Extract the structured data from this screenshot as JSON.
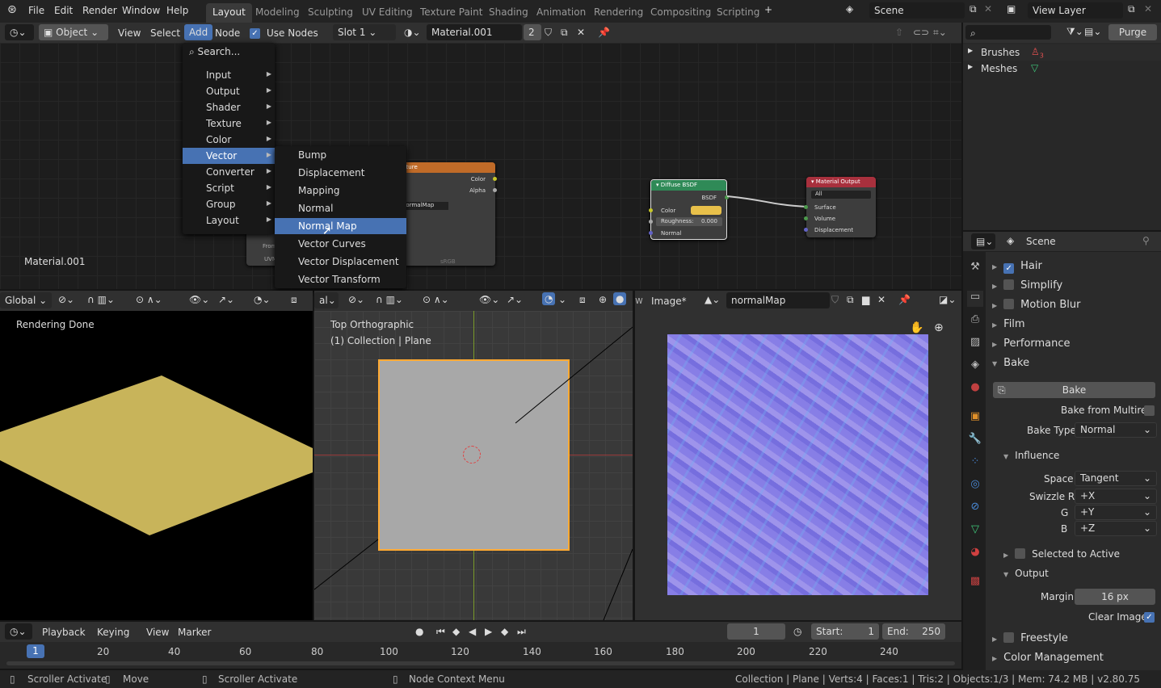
{
  "topbar": {
    "menus": [
      "File",
      "Edit",
      "Render",
      "Window",
      "Help"
    ],
    "workspaces": [
      "Layout",
      "Modeling",
      "Sculpting",
      "UV Editing",
      "Texture Paint",
      "Shading",
      "Animation",
      "Rendering",
      "Compositing",
      "Scripting"
    ],
    "active_workspace": "Layout",
    "scene": "Scene",
    "view_layer": "View Layer"
  },
  "node_header": {
    "mode": "Object",
    "menus": [
      "View",
      "Select",
      "Add",
      "Node"
    ],
    "use_nodes": "Use Nodes",
    "slot": "Slot 1",
    "material": "Material.001",
    "users": "2"
  },
  "node_editor": {
    "material_label": "Material.001",
    "image_node": {
      "title": "Image Texture",
      "out_color": "Color",
      "out_alpha": "Alpha",
      "image": "normalMap",
      "colorspace": "sRGB",
      "from": "From",
      "uv": "UVMap"
    },
    "diffuse": {
      "title": "Diffuse BSDF",
      "out": "BSDF",
      "color": "Color",
      "roughness_label": "Roughness:",
      "roughness": "0.000",
      "normal": "Normal",
      "color_hex": "#e8c04a"
    },
    "output": {
      "title": "Material Output",
      "target": "All",
      "surface": "Surface",
      "volume": "Volume",
      "displacement": "Displacement"
    }
  },
  "add_menu": {
    "search": "Search...",
    "items": [
      "Input",
      "Output",
      "Shader",
      "Texture",
      "Color",
      "Vector",
      "Converter",
      "Script",
      "Group",
      "Layout"
    ],
    "active": "Vector"
  },
  "vector_menu": {
    "items": [
      "Bump",
      "Displacement",
      "Mapping",
      "Normal",
      "Normal Map",
      "Vector Curves",
      "Vector Displacement",
      "Vector Transform"
    ],
    "highlighted": "Normal Map"
  },
  "outliner": {
    "purge": "Purge",
    "items": [
      "Brushes",
      "Meshes"
    ],
    "brush_count": "3"
  },
  "properties": {
    "context": "Scene",
    "panels": [
      {
        "label": "Hair",
        "check": true
      },
      {
        "label": "Simplify",
        "check": false
      },
      {
        "label": "Motion Blur",
        "check": false
      },
      {
        "label": "Film"
      },
      {
        "label": "Performance"
      }
    ],
    "bake": {
      "title": "Bake",
      "button": "Bake",
      "from_multires": "Bake from Multires",
      "type_label": "Bake Type",
      "type": "Normal",
      "influence": "Influence",
      "space_label": "Space",
      "space": "Tangent",
      "swizzle_r_label": "Swizzle R",
      "swizzle_r": "+X",
      "g_label": "G",
      "g": "+Y",
      "b_label": "B",
      "b": "+Z",
      "selected_to_active": "Selected to Active",
      "output": "Output",
      "margin_label": "Margin",
      "margin": "16 px",
      "clear_image": "Clear Image"
    },
    "freestyle": "Freestyle",
    "color_management": "Color Management"
  },
  "render_view": {
    "transform": "Global",
    "status": "Rendering Done"
  },
  "viewport": {
    "transform": "al",
    "view": "Top Orthographic",
    "collection": "(1) Collection | Plane"
  },
  "image_editor": {
    "view": "w",
    "menu": "Image*",
    "image": "normalMap"
  },
  "timeline": {
    "menus": [
      "Playback",
      "Keying",
      "View",
      "Marker"
    ],
    "frame": "1",
    "start_label": "Start:",
    "start": "1",
    "end_label": "End:",
    "end": "250",
    "ticks": [
      "1",
      "20",
      "40",
      "60",
      "80",
      "100",
      "120",
      "140",
      "160",
      "180",
      "200",
      "220",
      "240"
    ]
  },
  "statusbar": {
    "left1": "Scroller Activate",
    "left2": "Move",
    "left3": "Scroller Activate",
    "left4": "Node Context Menu",
    "stats": "Collection | Plane | Verts:4 | Faces:1 | Tris:2 | Objects:1/3 | Mem: 74.2 MB | v2.80.75"
  },
  "colors": {
    "accent": "#4772b3",
    "selection": "#ffaa33",
    "plane": "#c8b45a"
  }
}
